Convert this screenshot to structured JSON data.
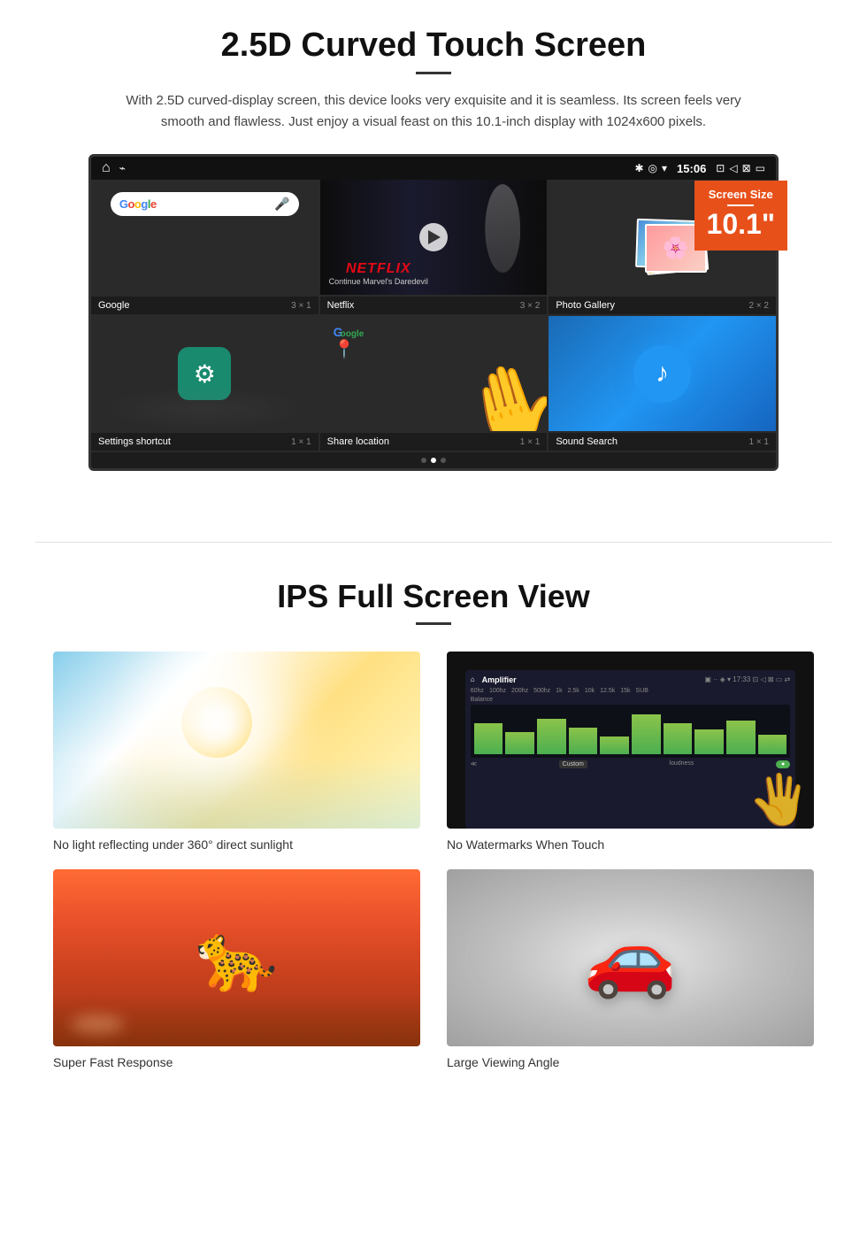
{
  "section1": {
    "title": "2.5D Curved Touch Screen",
    "description": "With 2.5D curved-display screen, this device looks very exquisite and it is seamless. Its screen feels very smooth and flawless. Just enjoy a visual feast on this 10.1-inch display with 1024x600 pixels.",
    "badge": {
      "label": "Screen Size",
      "size": "10.1\""
    },
    "statusbar": {
      "time": "15:06"
    },
    "apps_row1": [
      {
        "name": "Google",
        "size": "3 × 1"
      },
      {
        "name": "Netflix",
        "size": "3 × 2"
      },
      {
        "name": "Photo Gallery",
        "size": "2 × 2"
      }
    ],
    "apps_row2": [
      {
        "name": "Settings shortcut",
        "size": "1 × 1"
      },
      {
        "name": "Share location",
        "size": "1 × 1"
      },
      {
        "name": "Sound Search",
        "size": "1 × 1"
      }
    ],
    "netflix": {
      "logo": "NETFLIX",
      "subtitle": "Continue Marvel's Daredevil"
    }
  },
  "section2": {
    "title": "IPS Full Screen View",
    "features": [
      {
        "id": "sunlight",
        "label": "No light reflecting under 360° direct sunlight"
      },
      {
        "id": "amplifier",
        "label": "No Watermarks When Touch"
      },
      {
        "id": "cheetah",
        "label": "Super Fast Response"
      },
      {
        "id": "car",
        "label": "Large Viewing Angle"
      }
    ]
  }
}
